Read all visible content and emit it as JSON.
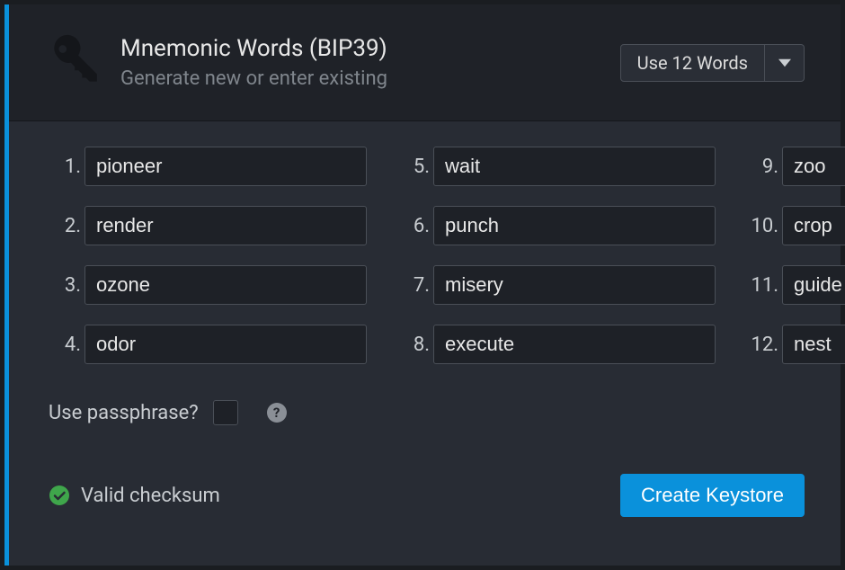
{
  "header": {
    "title": "Mnemonic Words (BIP39)",
    "subtitle": "Generate new or enter existing",
    "word_count_label": "Use 12 Words"
  },
  "words": [
    {
      "n": "1.",
      "value": "pioneer"
    },
    {
      "n": "2.",
      "value": "render"
    },
    {
      "n": "3.",
      "value": "ozone"
    },
    {
      "n": "4.",
      "value": "odor"
    },
    {
      "n": "5.",
      "value": "wait"
    },
    {
      "n": "6.",
      "value": "punch"
    },
    {
      "n": "7.",
      "value": "misery"
    },
    {
      "n": "8.",
      "value": "execute"
    },
    {
      "n": "9.",
      "value": "zoo"
    },
    {
      "n": "10.",
      "value": "crop"
    },
    {
      "n": "11.",
      "value": "guide"
    },
    {
      "n": "12.",
      "value": "nest"
    }
  ],
  "passphrase": {
    "label": "Use passphrase?",
    "checked": false,
    "help_glyph": "?"
  },
  "status": {
    "text": "Valid checksum",
    "color": "#3fa64b"
  },
  "action": {
    "create_label": "Create Keystore"
  }
}
